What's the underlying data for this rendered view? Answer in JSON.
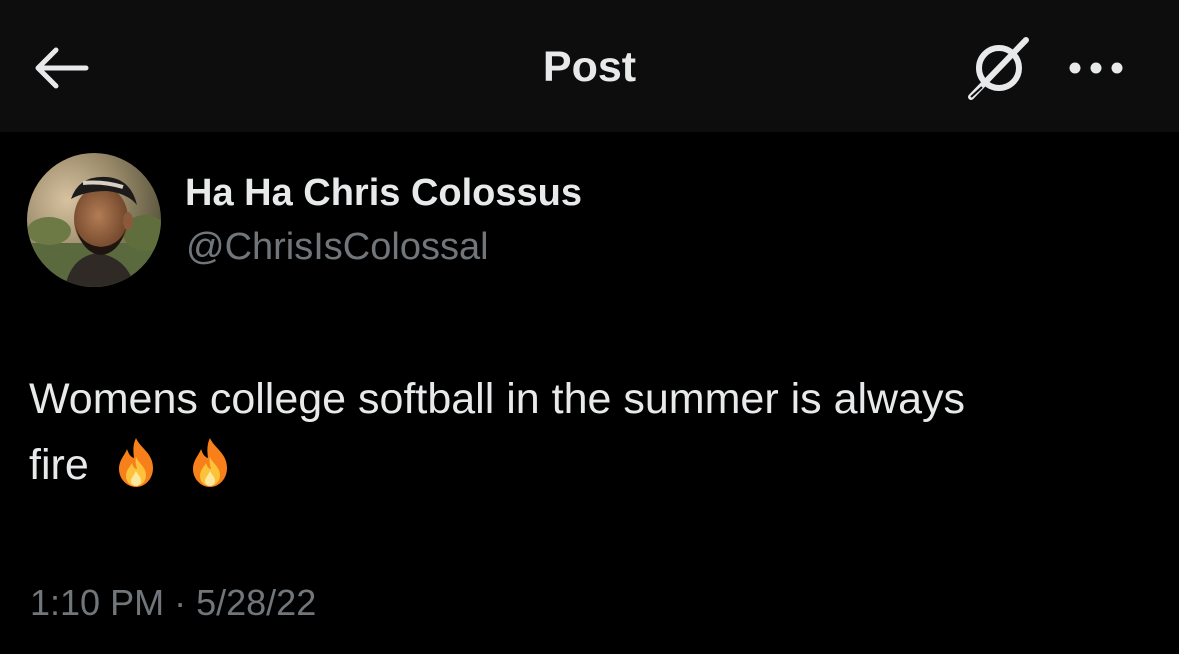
{
  "header": {
    "title": "Post",
    "back_icon": "arrow-left-icon",
    "grok_icon": "grok-slash-icon",
    "more_icon": "more-horizontal-icon"
  },
  "post": {
    "author_name": "Ha Ha Chris Colossus",
    "author_handle": "@ChrisIsColossal",
    "text_line1": "Womens college softball in the summer is always",
    "text_line2": "fire",
    "emojis": [
      "fire-emoji",
      "fire-emoji"
    ],
    "time": "1:10 PM",
    "separator": "·",
    "date": "5/28/22"
  },
  "colors": {
    "background": "#000000",
    "header_background": "#0d0d0d",
    "primary_text": "#e7e9ea",
    "secondary_text": "#71767b"
  }
}
